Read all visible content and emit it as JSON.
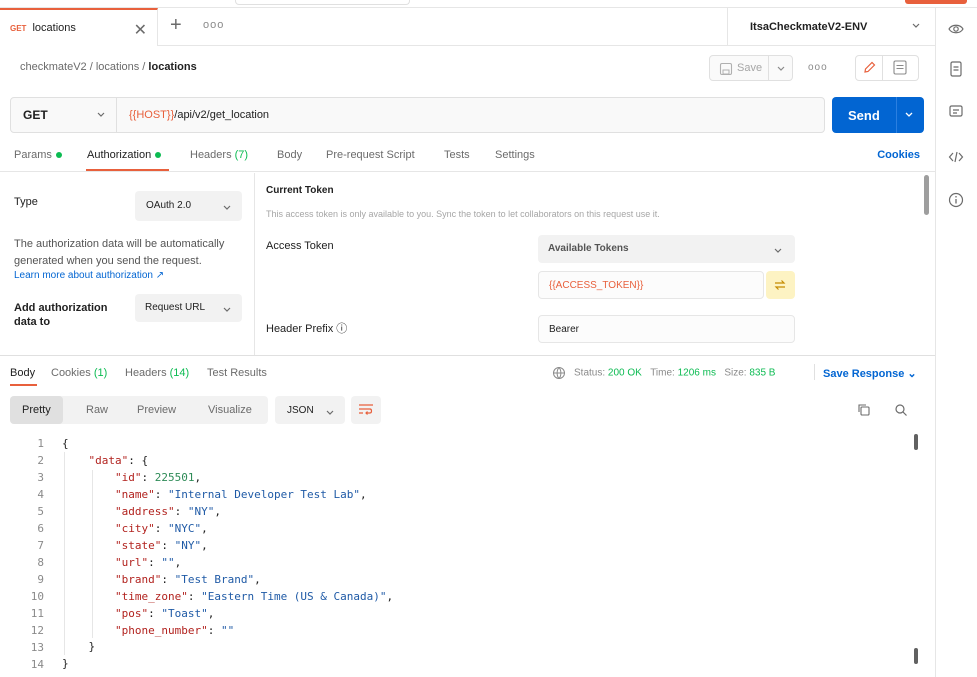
{
  "tab": {
    "method": "GET",
    "name": "locations"
  },
  "environment": "ItsaCheckmateV2-ENV",
  "breadcrumb": {
    "root": "checkmateV2",
    "folder": "locations",
    "current": "locations",
    "sep": " / "
  },
  "toolbar": {
    "save_label": "Save"
  },
  "request": {
    "method": "GET",
    "url_var": "{{HOST}}",
    "url_path": "/api/v2/get_location",
    "send_label": "Send"
  },
  "req_tabs": {
    "params": "Params",
    "authorization": "Authorization",
    "headers": "Headers",
    "headers_count": "(7)",
    "body": "Body",
    "prerequest": "Pre-request Script",
    "tests": "Tests",
    "settings": "Settings",
    "cookies": "Cookies"
  },
  "auth": {
    "type_label": "Type",
    "type_value": "OAuth 2.0",
    "help_text": "The authorization data will be automatically generated when you send the request.",
    "learn_more": "Learn more about authorization ↗",
    "add_label": "Add authorization data to",
    "add_value": "Request URL",
    "current_token_title": "Current Token",
    "current_token_note": "This access token is only available to you. Sync the token to let collaborators on this request use it.",
    "access_token_label": "Access Token",
    "available_tokens": "Available Tokens",
    "token_value": "{{ACCESS_TOKEN}}",
    "header_prefix_label": "Header Prefix ⓘ",
    "header_prefix_value": "Bearer"
  },
  "response": {
    "tabs": {
      "body": "Body",
      "cookies": "Cookies",
      "cookies_count": "(1)",
      "headers": "Headers",
      "headers_count": "(14)",
      "test_results": "Test Results"
    },
    "status_label": "Status:",
    "status_value": "200 OK",
    "time_label": "Time:",
    "time_value": "1206 ms",
    "size_label": "Size:",
    "size_value": "835 B",
    "save_response": "Save Response",
    "formats": [
      "Pretty",
      "Raw",
      "Preview",
      "Visualize"
    ],
    "format_type": "JSON",
    "line_numbers": [
      "1",
      "2",
      "3",
      "4",
      "5",
      "6",
      "7",
      "8",
      "9",
      "10",
      "11",
      "12",
      "13",
      "14"
    ],
    "json": {
      "root_key": "\"data\"",
      "fields": [
        {
          "key": "\"id\"",
          "value": "225501",
          "kind": "n"
        },
        {
          "key": "\"name\"",
          "value": "\"Internal Developer Test Lab\"",
          "kind": "s"
        },
        {
          "key": "\"address\"",
          "value": "\"NY\"",
          "kind": "s"
        },
        {
          "key": "\"city\"",
          "value": "\"NYC\"",
          "kind": "s"
        },
        {
          "key": "\"state\"",
          "value": "\"NY\"",
          "kind": "s"
        },
        {
          "key": "\"url\"",
          "value": "\"\"",
          "kind": "s"
        },
        {
          "key": "\"brand\"",
          "value": "\"Test Brand\"",
          "kind": "s"
        },
        {
          "key": "\"time_zone\"",
          "value": "\"Eastern Time (US & Canada)\"",
          "kind": "s"
        },
        {
          "key": "\"pos\"",
          "value": "\"Toast\"",
          "kind": "s"
        },
        {
          "key": "\"phone_number\"",
          "value": "\"\"",
          "kind": "s"
        }
      ]
    }
  },
  "colors": {
    "accent": "#e8603c",
    "primary": "#0265d2",
    "success": "#0cbb52",
    "key": "#b2231f",
    "string": "#1f5aa6",
    "number": "#2e8b57"
  }
}
